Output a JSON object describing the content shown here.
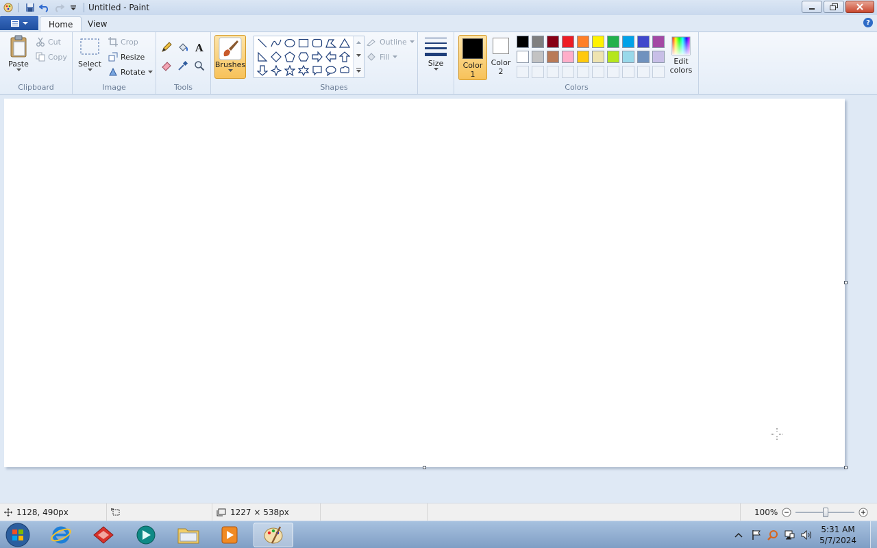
{
  "window": {
    "title": "Untitled - Paint"
  },
  "tabs": {
    "home": "Home",
    "view": "View"
  },
  "help": "?",
  "ribbon": {
    "clipboard": {
      "label": "Clipboard",
      "paste": "Paste",
      "cut": "Cut",
      "copy": "Copy"
    },
    "image": {
      "label": "Image",
      "select": "Select",
      "crop": "Crop",
      "resize": "Resize",
      "rotate": "Rotate"
    },
    "tools": {
      "label": "Tools"
    },
    "brushes": {
      "label": "Brushes"
    },
    "shapes": {
      "label": "Shapes",
      "outline": "Outline",
      "fill": "Fill"
    },
    "size": {
      "label": "Size"
    },
    "colors": {
      "label": "Colors",
      "color1_line1": "Color",
      "color1_line2": "1",
      "color2_line1": "Color",
      "color2_line2": "2",
      "edit_line1": "Edit",
      "edit_line2": "colors",
      "color1": "#000000",
      "color2": "#ffffff",
      "palette_row1": [
        "#000000",
        "#7f7f7f",
        "#880015",
        "#ed1c24",
        "#ff7f27",
        "#fff200",
        "#22b14c",
        "#00a2e8",
        "#3f48cc",
        "#a349a4"
      ],
      "palette_row2": [
        "#ffffff",
        "#c3c3c3",
        "#b97a57",
        "#ffaec9",
        "#ffc90e",
        "#efe4b0",
        "#b5e61d",
        "#99d9ea",
        "#7092be",
        "#c8bfe7"
      ]
    }
  },
  "status": {
    "cursor_pos": "1128, 490px",
    "image_size": "1227 × 538px",
    "zoom": "100%"
  },
  "taskbar": {
    "time": "5:31 AM",
    "date": "5/7/2024"
  },
  "accent": "#3a6cc1"
}
